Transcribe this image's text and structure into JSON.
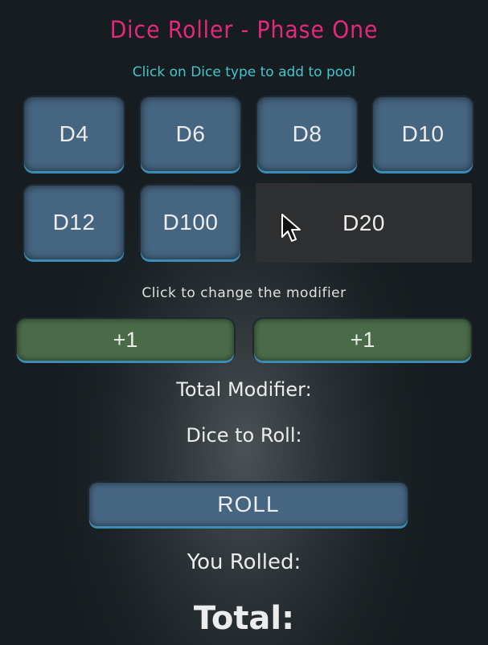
{
  "header": {
    "title": "Dice Roller - Phase One",
    "subtitle": "Click on Dice type to add to pool"
  },
  "dice": {
    "d4": "D4",
    "d6": "D6",
    "d8": "D8",
    "d10": "D10",
    "d12": "D12",
    "d100": "D100",
    "d20": "D20"
  },
  "modifier": {
    "hint": "Click to change the modifier",
    "left_value": "+1",
    "right_value": "+1"
  },
  "summary": {
    "total_modifier_label": "Total Modifier:",
    "dice_to_roll_label": "Dice to Roll:"
  },
  "roll": {
    "button_label": "ROLL",
    "you_rolled_label": "You Rolled:",
    "total_label": "Total:"
  },
  "colors": {
    "title": "#e5297a",
    "subtitle": "#3fc7cf",
    "die_button": "#466581",
    "modifier_button": "#4a6b48",
    "button_edge": "#3a8db6"
  },
  "icons": {
    "cursor": "mouse-pointer-icon"
  }
}
